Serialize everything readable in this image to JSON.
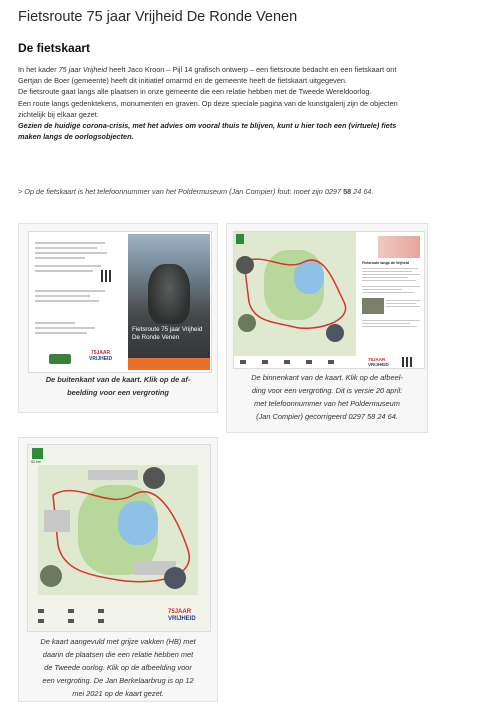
{
  "page": {
    "title": "Fietsroute 75 jaar Vrijheid De Ronde Venen"
  },
  "section": {
    "title": "De fietskaart"
  },
  "intro": {
    "line1_a": "In het kader ",
    "line1_em": "75 jaar Vrijheid",
    "line1_b": " heeft Jaco Kroon – Pijl 14 grafisch ontwerp – een fietsroute bedacht en een fietskaart ont",
    "line2": "Gertjan de Boer (gemeente) heeft dit initiatief omarmd en de gemeente heeft de fietskaart uitgegeven.",
    "line3": "De fietsroute gaat langs alle plaatsen in onze gemeente die een relatie hebben met de Tweede Wereldoorlog.",
    "line4": "Een route langs gedenktekens, monumenten en graven. Op deze speciale pagina van de kunstgalerij zijn de objecten",
    "line5": "zichtelijk bij elkaar gezet.",
    "line6": "Gezien de huidige corona-crisis, met het advies om vooral thuis te blijven, kunt u hier toch een (virtuele) fiets",
    "line7": "maken langs de oorlogsobjecten."
  },
  "correction": {
    "text_a": "> Op de fietskaart is het telefoonnummer van het Poldermuseum (Jan Compier) fout: moet zijn 0297 ",
    "text_bold": "58",
    "text_b": " 24 64."
  },
  "cards": [
    {
      "caption_lines": [
        "De buitenkant van de kaart. Klik op de af-",
        "beelding voor een vergroting"
      ],
      "cover_title_1": "Fietsroute 75 jaar Vrijheid",
      "cover_title_2": "De Ronde Venen",
      "logo_text_1": "75",
      "logo_text_2": "JAAR",
      "logo_text_3": "VRIJHEID"
    },
    {
      "caption_lines": [
        "De binnenkant van de kaart. Klik op de afbeel-",
        "ding voor een vergroting. Dit is versie 20 april:",
        "met telefoonnummer van het Poldermuseum",
        "(Jan Compier) gecorrigeerd 0297 58 24 64."
      ],
      "panel_title": "Fietsroute langs de Vrijheid",
      "logo_text_1": "75",
      "logo_text_2": "JAAR",
      "logo_text_3": "VRIJHEID"
    },
    {
      "caption_lines": [
        "De kaart aangevuld met grijze vakken (HB) met",
        "daarin de plaatsen die een relatie hebben met",
        "de Tweede oorlog. Klik op de afbeelding voor",
        "een vergroting. De Jan Berkelaarbrug is op 12",
        "mei 2021 op de kaart gezet."
      ],
      "route_label": "52 km",
      "logo_text_1": "75",
      "logo_text_2": "JAAR",
      "logo_text_3": "VRIJHEID"
    }
  ],
  "colors": {
    "accent_orange": "#e8702a",
    "map_green": "#b8d79a",
    "map_water": "#8fc1e6",
    "route_red": "#d8342c"
  }
}
